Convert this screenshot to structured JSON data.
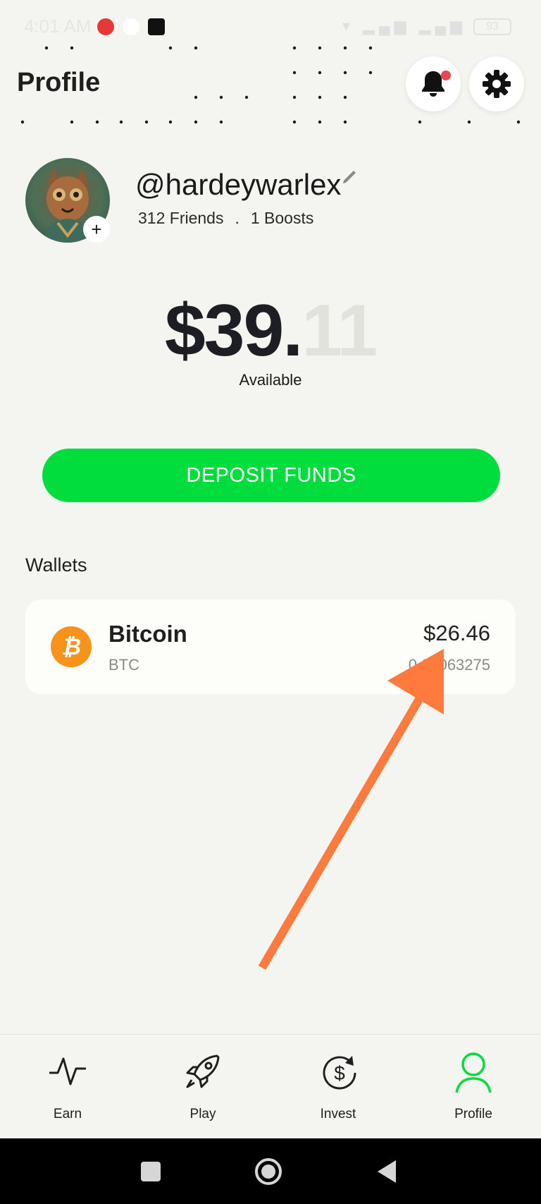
{
  "status_bar": {
    "time": "4:01 AM",
    "battery": "93"
  },
  "header": {
    "title": "Profile"
  },
  "profile": {
    "username": "@hardeywarlex",
    "friends": "312 Friends",
    "separator": ".",
    "boosts": "1 Boosts"
  },
  "balance": {
    "dollars": "$39.",
    "cents": "11",
    "caption": "Available"
  },
  "deposit": {
    "label": "DEPOSIT FUNDS"
  },
  "wallets": {
    "title": "Wallets",
    "items": [
      {
        "name": "Bitcoin",
        "ticker": "BTC",
        "usd": "$26.46",
        "amount": "0.00063275",
        "icon": "bitcoin-icon"
      }
    ]
  },
  "nav": {
    "items": [
      {
        "label": "Earn",
        "icon": "activity-icon"
      },
      {
        "label": "Play",
        "icon": "rocket-icon"
      },
      {
        "label": "Invest",
        "icon": "dollar-cycle-icon"
      },
      {
        "label": "Profile",
        "icon": "user-icon",
        "active": true
      }
    ]
  },
  "colors": {
    "accent": "#00dd3d",
    "bitcoin": "#f5931b",
    "annotation_arrow": "#ff7a3d",
    "notification": "#e8454f"
  }
}
